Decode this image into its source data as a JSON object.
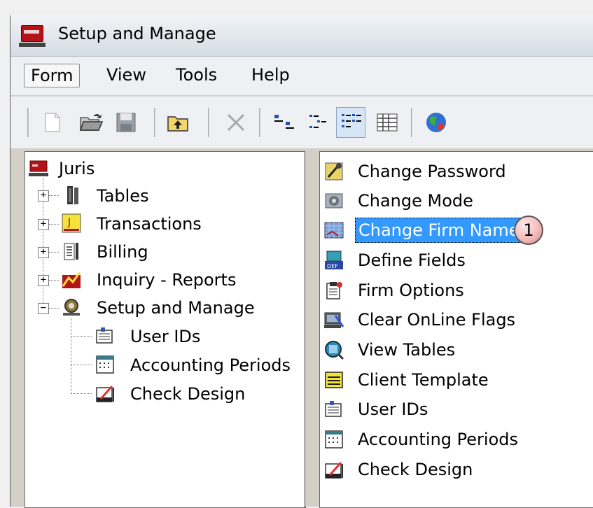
{
  "window": {
    "title": "Setup and Manage",
    "app_icon_text": "Juris"
  },
  "menu": {
    "items": [
      "Form",
      "View",
      "Tools",
      "Help"
    ],
    "active": "Form"
  },
  "toolbar": {
    "buttons": [
      "new-icon",
      "open-folder-icon",
      "save-icon",
      "up-folder-icon",
      "delete-icon",
      "large-icons-icon",
      "small-icons-icon",
      "list-view-icon",
      "details-view-icon",
      "globe-icon"
    ],
    "pressed": "list-view-icon"
  },
  "tree": {
    "root": "Juris",
    "nodes": [
      {
        "label": "Tables",
        "expanded": false
      },
      {
        "label": "Transactions",
        "expanded": false
      },
      {
        "label": "Billing",
        "expanded": false
      },
      {
        "label": "Inquiry - Reports",
        "expanded": false
      },
      {
        "label": "Setup and Manage",
        "expanded": true
      }
    ],
    "children": [
      "User IDs",
      "Accounting Periods",
      "Check Design"
    ]
  },
  "list": {
    "items": [
      "Change Password",
      "Change Mode",
      "Change Firm Name",
      "Define Fields",
      "Firm Options",
      "Clear OnLine Flags",
      "View Tables",
      "Client Template",
      "User IDs",
      "Accounting Periods",
      "Check Design"
    ],
    "selected": "Change Firm Name"
  },
  "callout": {
    "number": "1"
  },
  "colors": {
    "selection": "#3399ff",
    "brand": "#b3141a"
  }
}
